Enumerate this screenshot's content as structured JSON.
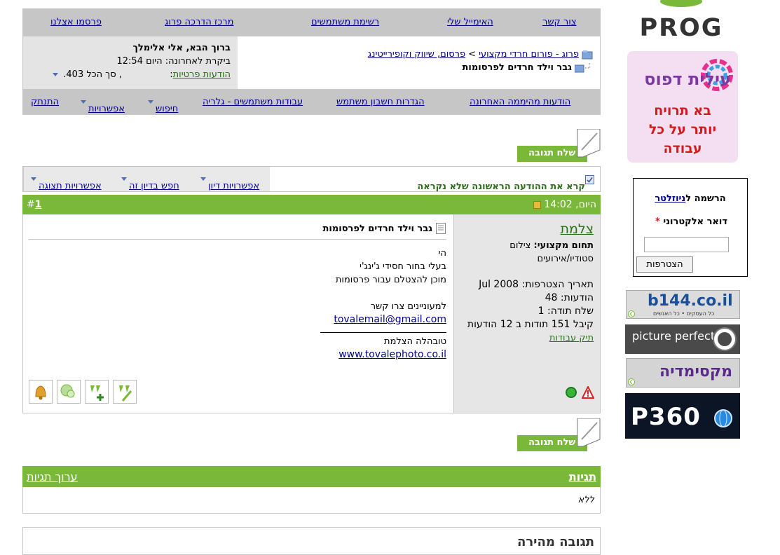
{
  "topnav": {
    "items": [
      "צור קשר",
      "האימייל שלי",
      "רשימת משתמשים",
      "מרכז הדרכה פרוג",
      "פרסמו אצלנו"
    ]
  },
  "user": {
    "welcome": "ברוך הבא, אלי אלימלך",
    "last_visit": "ביקרת לאחרונה: היום 12:54",
    "private_messages": "הודעות פרטיות",
    "pm_sep": ":",
    "pm_summary": ", סך הכל 403."
  },
  "breadcrumb": {
    "forum_link": "פרוג - פורום חרדי מקצועי",
    "sep": ">",
    "sub_link": "פרסום, שיווק וקופירייטינג",
    "current": "גבר וילד חרדים לפרסומות"
  },
  "nav2": {
    "items": [
      "הודעות מהיממה האחרונה",
      "הגדרות חשבון משתמש",
      "עבודות משתמשים - גלריה",
      "חיפוש",
      "אפשרויות",
      "התנתק"
    ]
  },
  "reply_button": "שלח תגובה",
  "tools": {
    "first_unread": "קרא את ההודעה הראשונה שלא נקראה",
    "thread_tools": "אפשרויות דיון",
    "search_thread": "חפש בדיון זה",
    "display_modes": "אפשרויות תצוגה"
  },
  "post": {
    "date": "היום, 14:02",
    "hash": "#",
    "number": "1",
    "author": "צלמת",
    "field_label": "תחום מקצועי:",
    "field_value": "צילום",
    "field_value2": "סטודיו/אירועים",
    "join_date": "תאריך הצטרפות: Jul 2008",
    "posts": "הודעות: 48",
    "thanks_sent": "שלח תודה: 1",
    "thanks_received": "קיבל 151 תודות ב 12 הודעות",
    "portfolio": "תיק עבודות",
    "title": "גבר וילד חרדים לפרסומות",
    "lines": [
      "הי",
      "בעלי בחור חסידי ג'ינג'י",
      "מוכן להצטלם עבור פרסומות",
      "",
      "למעוניינים צרו קשר"
    ],
    "email": "tovalemail@gmail.com",
    "signature": "טובהלה הצלמת",
    "website": "www.tovalephoto.co.il"
  },
  "tags": {
    "title": "תגיות",
    "edit": "ערוך תגיות",
    "none": "ללא"
  },
  "quick_reply": {
    "title": "תגובה מהירה"
  },
  "sidebar": {
    "logo": "PROG",
    "ad1": {
      "brand": "עילית דפוס",
      "line1": "בא תרויח",
      "line2": "יותר על כל",
      "line3": "עבודה"
    },
    "newsletter": {
      "register": "הרשמה ל",
      "newsletter_link": "ניוזלטר",
      "email_label": "דואר אלקטרוני",
      "required": "*",
      "submit": "הצטרפות"
    },
    "b144": "b144.co.il",
    "b144_sub": "כל העסקים • כל האנשים",
    "picture_perfect": "picture perfect",
    "maxi": "מקסימדיה",
    "p360": "P360"
  },
  "colors": {
    "green": "#79b839",
    "gray": "#c6c6c6",
    "link": "#00008b"
  }
}
